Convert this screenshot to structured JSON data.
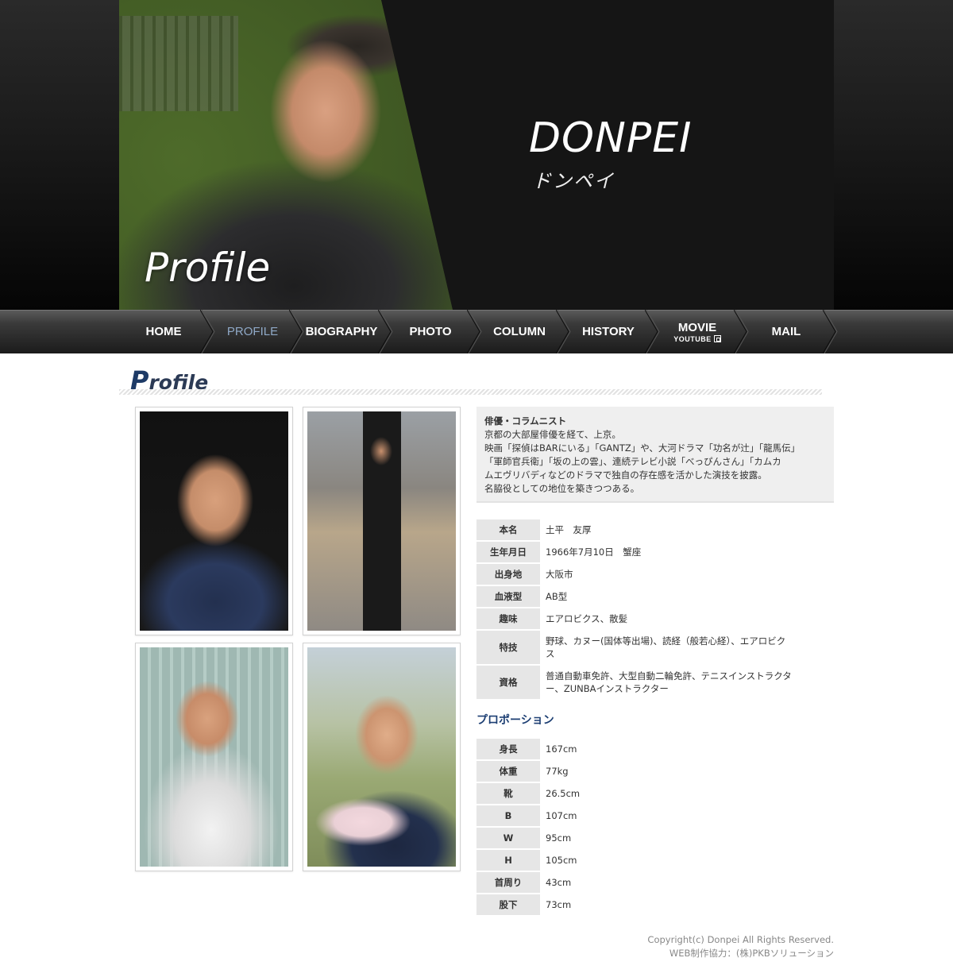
{
  "header": {
    "brand_name": "DONPEI",
    "brand_kana": "ドンペイ",
    "page_title": "Profile"
  },
  "nav": [
    {
      "label": "HOME",
      "sub": "",
      "active": false
    },
    {
      "label": "PROFILE",
      "sub": "",
      "active": true
    },
    {
      "label": "BIOGRAPHY",
      "sub": "",
      "active": false
    },
    {
      "label": "PHOTO",
      "sub": "",
      "active": false
    },
    {
      "label": "COLUMN",
      "sub": "",
      "active": false
    },
    {
      "label": "HISTORY",
      "sub": "",
      "active": false
    },
    {
      "label": "MOVIE",
      "sub": "YOUTUBE",
      "active": false
    },
    {
      "label": "MAIL",
      "sub": "",
      "active": false
    }
  ],
  "section": {
    "title_initial": "P",
    "title_rest": "rofile"
  },
  "intro": {
    "lead": "俳優・コラムニスト",
    "lines": [
      "京都の大部屋俳優を経て、上京。",
      "映画「探偵はBARにいる」「GANTZ」や、大河ドラマ「功名が辻」「龍馬伝」",
      "「軍師官兵衛」「坂の上の雲」、連続テレビ小説「べっぴんさん」「カムカ",
      "ムエヴリバディなどのドラマで独自の存在感を活かした演技を披露。",
      "名脇役としての地位を築きつつある。"
    ]
  },
  "profile_table": [
    {
      "label": "本名",
      "value": "土平　友厚"
    },
    {
      "label": "生年月日",
      "value": "1966年7月10日　蟹座"
    },
    {
      "label": "出身地",
      "value": "大阪市"
    },
    {
      "label": "血液型",
      "value": "AB型"
    },
    {
      "label": "趣味",
      "value": "エアロビクス、散髪"
    },
    {
      "label": "特技",
      "value": "野球、カヌー(国体等出場)、読経（般若心経）、エアロビクス"
    },
    {
      "label": "資格",
      "value": "普通自動車免許、大型自動二輪免許、テニスインストラクター、ZUNBAインストラクター"
    }
  ],
  "proportion_heading": "プロポーション",
  "proportion_table": [
    {
      "label": "身長",
      "value": "167cm"
    },
    {
      "label": "体重",
      "value": "77kg"
    },
    {
      "label": "靴",
      "value": "26.5cm"
    },
    {
      "label": "B",
      "value": "107cm"
    },
    {
      "label": "W",
      "value": "95cm"
    },
    {
      "label": "H",
      "value": "105cm"
    },
    {
      "label": "首周り",
      "value": "43cm"
    },
    {
      "label": "股下",
      "value": "73cm"
    }
  ],
  "footer": {
    "copyright": "Copyright(c) Donpei All Rights Reserved.",
    "credit": "WEB制作協力：(株)PKBソリューション"
  },
  "colors": {
    "accent": "#1d3f73",
    "nav_active": "#8fa9c7",
    "table_header_bg": "#e6e6e6"
  }
}
